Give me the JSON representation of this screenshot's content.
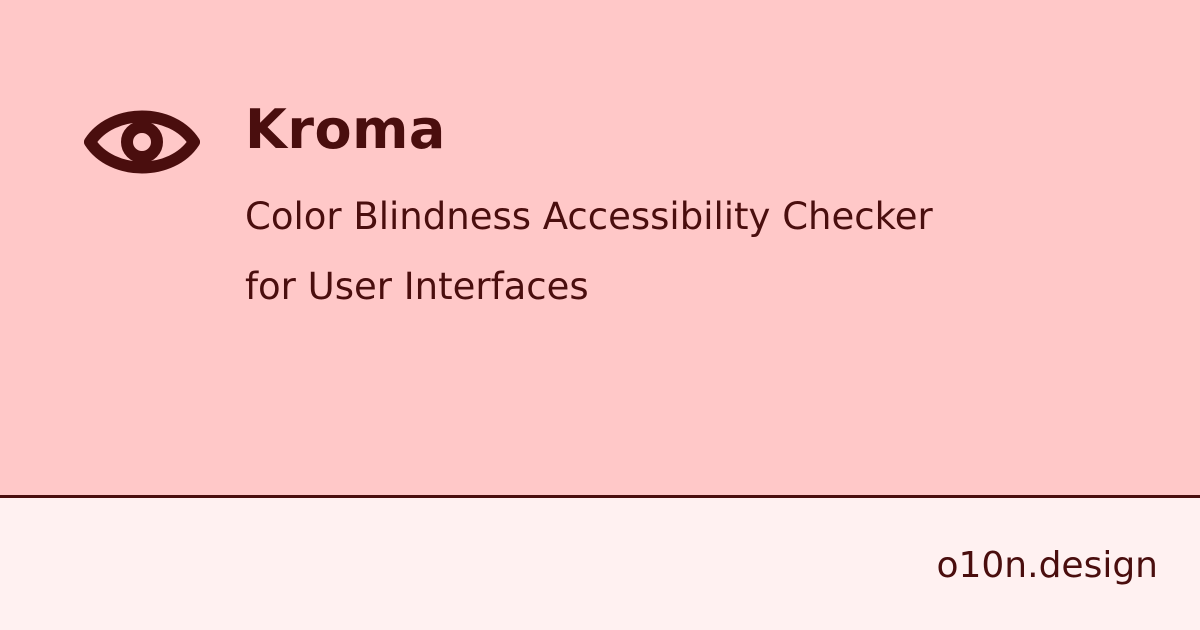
{
  "brand": {
    "title": "Kroma",
    "icon": "eye-icon",
    "subtitle_line1": "Color Blindness Accessibility Checker",
    "subtitle_line2": "for User Interfaces"
  },
  "footer": {
    "domain": "o10n.design"
  },
  "colors": {
    "hero_background": "#FFC8C8",
    "footer_background": "#FFF1F1",
    "text": "#4A0E0E",
    "divider": "#4A0E0E"
  }
}
